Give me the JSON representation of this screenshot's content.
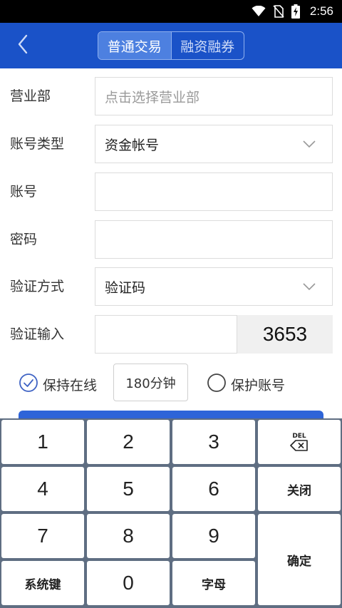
{
  "status_bar": {
    "time": "2:56",
    "icons": [
      "wifi-icon",
      "no-sim-icon",
      "battery-charging-icon"
    ]
  },
  "header": {
    "back_icon": "chevron-left-icon",
    "tabs": [
      {
        "label": "普通交易",
        "active": true
      },
      {
        "label": "融资融券",
        "active": false
      }
    ]
  },
  "form": {
    "branch": {
      "label": "营业部",
      "value": "",
      "placeholder": "点击选择营业部"
    },
    "account_type": {
      "label": "账号类型",
      "value": "资金帐号"
    },
    "account": {
      "label": "账号",
      "value": ""
    },
    "password": {
      "label": "密码",
      "value": ""
    },
    "verify_method": {
      "label": "验证方式",
      "value": "验证码"
    },
    "verify_input": {
      "label": "验证输入",
      "value": "",
      "captcha": "3653"
    }
  },
  "options": {
    "keep_online": {
      "label": "保持在线",
      "checked": true
    },
    "duration": "180分钟",
    "protect_account": {
      "label": "保护账号",
      "checked": false
    }
  },
  "keypad": {
    "keys": [
      "1",
      "2",
      "3",
      "4",
      "5",
      "6",
      "7",
      "8",
      "9",
      "0"
    ],
    "delete_label": "DEL",
    "close_label": "关闭",
    "confirm_label": "确定",
    "system_label": "系统键",
    "letters_label": "字母"
  },
  "colors": {
    "header_bg": "#1a52c8",
    "active_tab": "#4d80e0",
    "keypad_bg": "#5f6e82",
    "primary_button": "#2e64d8"
  }
}
